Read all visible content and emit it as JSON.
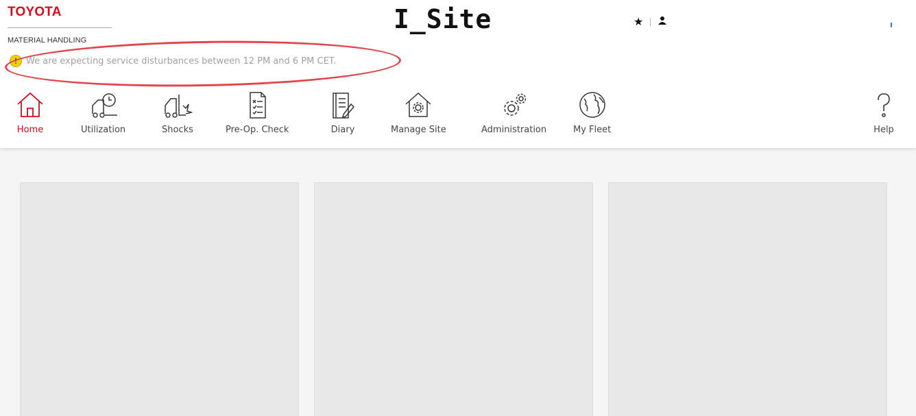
{
  "brand": {
    "name": "TOYOTA",
    "sub": "MATERIAL HANDLING"
  },
  "app_title": "I_Site",
  "top_icons": [
    "star-icon",
    "user-icon"
  ],
  "alert": {
    "icon": "exclamation-icon",
    "text": "We are expecting service disturbances between 12 PM and 6 PM CET."
  },
  "nav": {
    "items": [
      {
        "label": "Home",
        "icon": "home-icon",
        "active": true
      },
      {
        "label": "Utilization",
        "icon": "forklift-clock-icon"
      },
      {
        "label": "Shocks",
        "icon": "forklift-impact-icon"
      },
      {
        "label": "Pre-Op. Check",
        "icon": "checklist-icon"
      },
      {
        "label": "Diary",
        "icon": "notebook-pen-icon"
      },
      {
        "label": "Manage Site",
        "icon": "house-gear-icon"
      },
      {
        "label": "Administration",
        "icon": "gears-icon"
      },
      {
        "label": "My Fleet",
        "icon": "globe-icon"
      },
      {
        "label": "Help",
        "icon": "question-icon"
      }
    ]
  },
  "colors": {
    "brand_red": "#d50b1e",
    "alert_yellow": "#f5d000",
    "annotation_ring": "#e0464c",
    "card_bg": "#e8e8e8"
  }
}
